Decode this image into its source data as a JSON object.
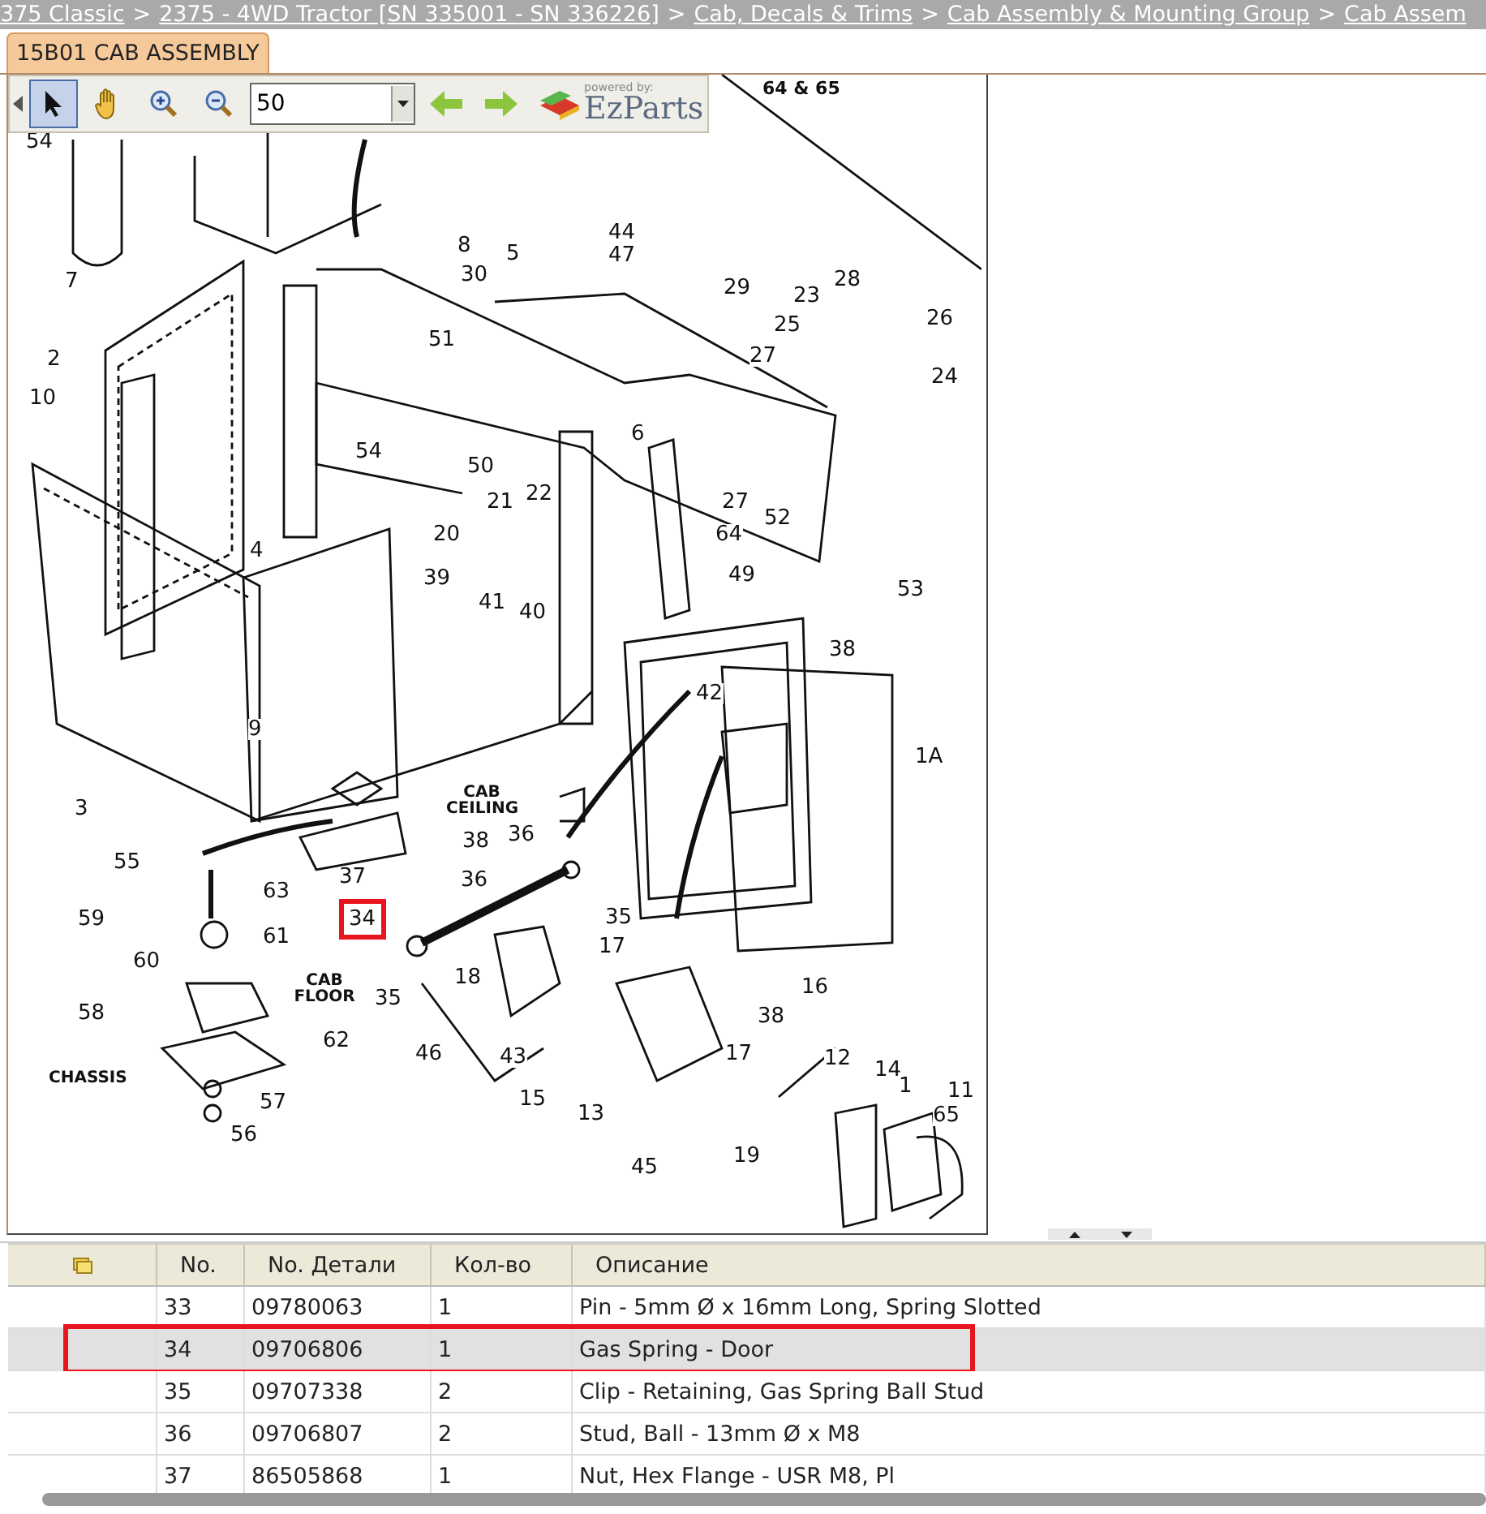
{
  "breadcrumb": {
    "separator": ">",
    "items": [
      "375 Classic",
      "2375 - 4WD Tractor [SN 335001 - SN 336226]",
      "Cab, Decals & Trims",
      "Cab Assembly & Mounting Group",
      "Cab Assem"
    ]
  },
  "tab": {
    "label": "15B01 CAB ASSEMBLY",
    "selected": true
  },
  "toolbar": {
    "tools": [
      {
        "kind": "pointer",
        "selected": true
      },
      {
        "kind": "hand",
        "selected": false
      }
    ],
    "zoom_value": "50",
    "logo": {
      "tagline": "powered by:",
      "name": "EzParts"
    }
  },
  "diagram": {
    "note": "64 & 65",
    "callouts": [
      {
        "text": "54",
        "selected": false
      },
      {
        "text": "8",
        "selected": false
      },
      {
        "text": "5",
        "selected": false
      },
      {
        "text": "44",
        "selected": false
      },
      {
        "text": "47",
        "selected": false
      },
      {
        "text": "30",
        "selected": false
      },
      {
        "text": "29",
        "selected": false
      },
      {
        "text": "28",
        "selected": false
      },
      {
        "text": "23",
        "selected": false
      },
      {
        "text": "26",
        "selected": false
      },
      {
        "text": "25",
        "selected": false
      },
      {
        "text": "27",
        "selected": false
      },
      {
        "text": "24",
        "selected": false
      },
      {
        "text": "7",
        "selected": false
      },
      {
        "text": "2",
        "selected": false
      },
      {
        "text": "10",
        "selected": false
      },
      {
        "text": "51",
        "selected": false
      },
      {
        "text": "54",
        "selected": false
      },
      {
        "text": "50",
        "selected": false
      },
      {
        "text": "6",
        "selected": false
      },
      {
        "text": "21",
        "selected": false
      },
      {
        "text": "22",
        "selected": false
      },
      {
        "text": "27",
        "selected": false
      },
      {
        "text": "64",
        "selected": false
      },
      {
        "text": "52",
        "selected": false
      },
      {
        "text": "49",
        "selected": false
      },
      {
        "text": "53",
        "selected": false
      },
      {
        "text": "20",
        "selected": false
      },
      {
        "text": "39",
        "selected": false
      },
      {
        "text": "41",
        "selected": false
      },
      {
        "text": "40",
        "selected": false
      },
      {
        "text": "4",
        "selected": false
      },
      {
        "text": "38",
        "selected": false
      },
      {
        "text": "42",
        "selected": false
      },
      {
        "text": "1A",
        "selected": false
      },
      {
        "text": "9",
        "selected": false
      },
      {
        "text": "3",
        "selected": false
      },
      {
        "text": "36",
        "selected": false
      },
      {
        "text": "38",
        "selected": false
      },
      {
        "text": "37",
        "selected": false
      },
      {
        "text": "36",
        "selected": false
      },
      {
        "text": "55",
        "selected": false
      },
      {
        "text": "63",
        "selected": false
      },
      {
        "text": "59",
        "selected": false
      },
      {
        "text": "61",
        "selected": false
      },
      {
        "text": "34",
        "selected": true
      },
      {
        "text": "35",
        "selected": false
      },
      {
        "text": "17",
        "selected": false
      },
      {
        "text": "35",
        "selected": false
      },
      {
        "text": "18",
        "selected": false
      },
      {
        "text": "60",
        "selected": false
      },
      {
        "text": "16",
        "selected": false
      },
      {
        "text": "38",
        "selected": false
      },
      {
        "text": "58",
        "selected": false
      },
      {
        "text": "62",
        "selected": false
      },
      {
        "text": "17",
        "selected": false
      },
      {
        "text": "12",
        "selected": false
      },
      {
        "text": "14",
        "selected": false
      },
      {
        "text": "1",
        "selected": false
      },
      {
        "text": "11",
        "selected": false
      },
      {
        "text": "65",
        "selected": false
      },
      {
        "text": "46",
        "selected": false
      },
      {
        "text": "43",
        "selected": false
      },
      {
        "text": "15",
        "selected": false
      },
      {
        "text": "13",
        "selected": false
      },
      {
        "text": "57",
        "selected": false
      },
      {
        "text": "19",
        "selected": false
      },
      {
        "text": "56",
        "selected": false
      },
      {
        "text": "45",
        "selected": false
      }
    ],
    "captions": [
      "CAB CEILING",
      "CAB FLOOR",
      "CHASSIS"
    ]
  },
  "table": {
    "columns": [
      "No.",
      "No. Детали",
      "Кол-во",
      "Описание"
    ],
    "rows": [
      {
        "no": "33",
        "part_no": "09780063",
        "qty": "1",
        "description": "Pin - 5mm Ø x 16mm Long, Spring Slotted",
        "selected": false
      },
      {
        "no": "34",
        "part_no": "09706806",
        "qty": "1",
        "description": "Gas Spring - Door",
        "selected": true
      },
      {
        "no": "35",
        "part_no": "09707338",
        "qty": "2",
        "description": "Clip - Retaining, Gas Spring Ball Stud",
        "selected": false
      },
      {
        "no": "36",
        "part_no": "09706807",
        "qty": "2",
        "description": "Stud, Ball - 13mm Ø x M8",
        "selected": false
      },
      {
        "no": "37",
        "part_no": "86505868",
        "qty": "1",
        "description": "Nut, Hex Flange - USR M8, Pl",
        "selected": false
      }
    ]
  }
}
